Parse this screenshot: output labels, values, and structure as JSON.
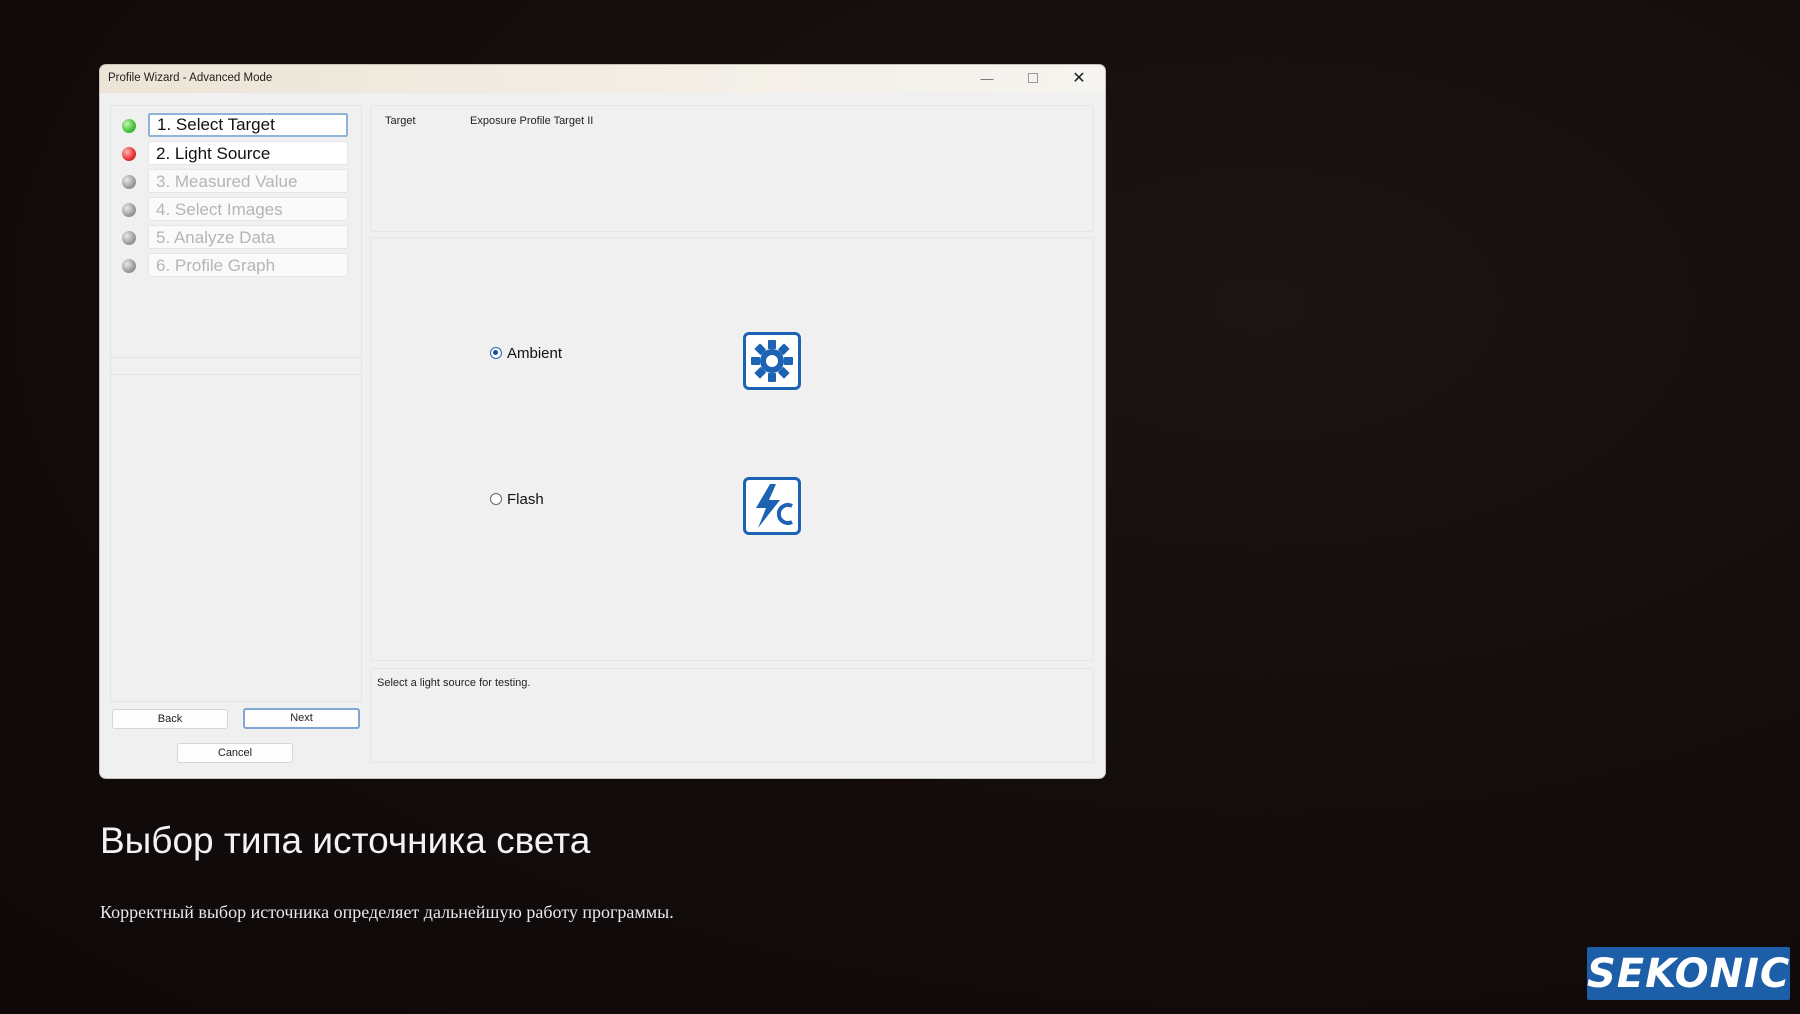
{
  "window": {
    "title": "Profile Wizard - Advanced Mode",
    "controls": {
      "minimize": "—",
      "close": "✕"
    }
  },
  "steps": [
    {
      "label": "1. Select Target",
      "status": "green",
      "state": "active"
    },
    {
      "label": "2. Light Source",
      "status": "red",
      "state": "current"
    },
    {
      "label": "3. Measured Value",
      "status": "gray",
      "state": "disabled"
    },
    {
      "label": "4. Select Images",
      "status": "gray",
      "state": "disabled"
    },
    {
      "label": "5. Analyze Data",
      "status": "gray",
      "state": "disabled"
    },
    {
      "label": "6. Profile Graph",
      "status": "gray",
      "state": "disabled"
    }
  ],
  "buttons": {
    "back": "Back",
    "next": "Next",
    "cancel": "Cancel"
  },
  "target": {
    "label": "Target",
    "value": "Exposure Profile Target II"
  },
  "light_source": {
    "options": [
      {
        "label": "Ambient",
        "checked": true,
        "icon": "ambient-sun-icon"
      },
      {
        "label": "Flash",
        "checked": false,
        "icon": "flash-cord-icon"
      }
    ]
  },
  "hint": "Select a light source for testing.",
  "slide": {
    "heading": "Выбор типа источника света",
    "subtext": "Корректный выбор источника определяет дальнейшую работу программы."
  },
  "logo": "SEKONIC",
  "colors": {
    "accent": "#1d63b3",
    "logo_bg": "#1d5ea8",
    "background": "#130c0c"
  }
}
